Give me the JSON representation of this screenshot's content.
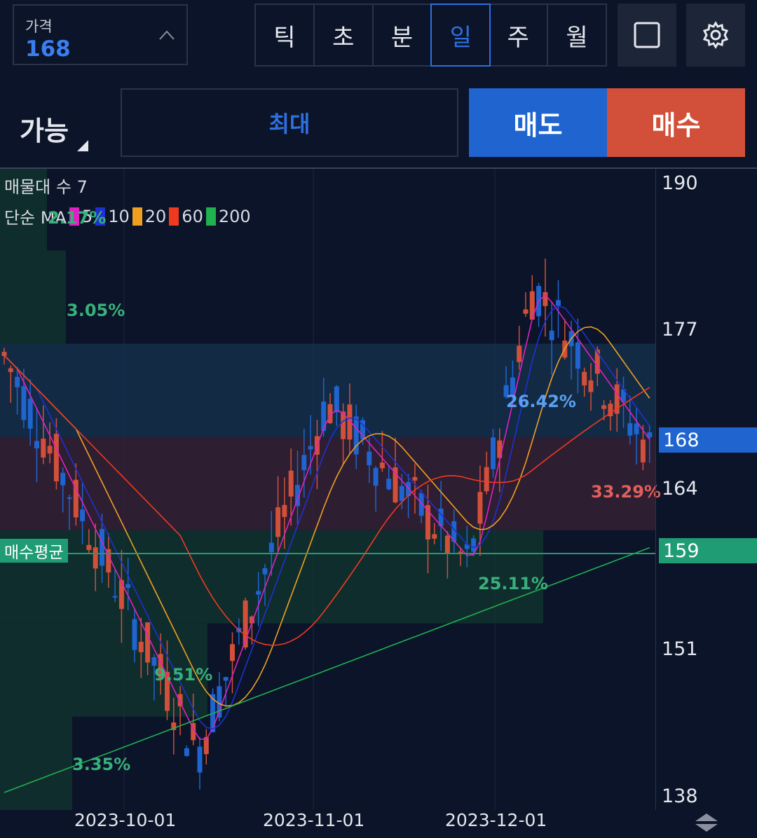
{
  "price_selector": {
    "label": "가격",
    "value": "168"
  },
  "timeframes": [
    "틱",
    "초",
    "분",
    "일",
    "주",
    "월"
  ],
  "active_timeframe": "일",
  "icons": {
    "square": "square-icon",
    "settings": "gear-icon",
    "chevron": "chevron-up-icon",
    "scroll": "scroll-arrows-icon"
  },
  "order": {
    "avail_label": "가능",
    "max_label": "최대",
    "sell_label": "매도",
    "buy_label": "매수"
  },
  "colors": {
    "sell": "#1f64cf",
    "buy": "#d2503a",
    "up_candle": "#d2503a",
    "down_candle": "#1f64cf",
    "avg_line": "#1f9c74"
  },
  "legend": {
    "volume_profile": "매물대 수 7",
    "ma_label": "단순 MA",
    "ma_periods": [
      {
        "period": "5",
        "color": "#e020c0"
      },
      {
        "period": "10",
        "color": "#2030d0"
      },
      {
        "period": "20",
        "color": "#f0a020"
      },
      {
        "period": "60",
        "color": "#f03a20"
      },
      {
        "period": "200",
        "color": "#20b050"
      }
    ]
  },
  "chart_data": {
    "type": "candlestick",
    "y_ticks": [
      "190",
      "177",
      "164",
      "151",
      "138"
    ],
    "x_ticks": [
      "2023-10-01",
      "2023-11-01",
      "2023-12-01"
    ],
    "current_price": "168",
    "buy_average_label": "매수평균",
    "buy_average_value": "159",
    "ylim": [
      137,
      192
    ],
    "volume_profile": [
      {
        "label": "3.35%",
        "low": 137,
        "high": 145
      },
      {
        "label": "9.51%",
        "low": 145,
        "high": 153
      },
      {
        "label": "25.11%",
        "low": 153,
        "high": 161
      },
      {
        "label": "33.29%",
        "low": 161,
        "high": 169
      },
      {
        "label": "26.42%",
        "low": 169,
        "high": 177
      },
      {
        "label": "3.05%",
        "low": 177,
        "high": 185
      },
      {
        "label": "2.17%",
        "low": 185,
        "high": 193
      }
    ]
  }
}
